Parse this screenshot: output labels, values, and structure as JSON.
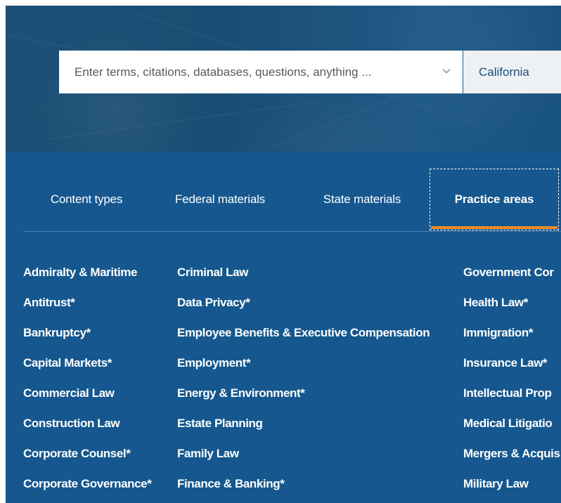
{
  "search": {
    "placeholder": "Enter terms, citations, databases, questions, anything ...",
    "value": "",
    "dropdown_icon": "chevron-down-icon",
    "jurisdiction": "California"
  },
  "tabs": [
    {
      "label": "Content types",
      "active": false
    },
    {
      "label": "Federal materials",
      "active": false
    },
    {
      "label": "State materials",
      "active": false
    },
    {
      "label": "Practice areas",
      "active": true
    }
  ],
  "practice_areas": {
    "columns": [
      [
        "Admiralty & Maritime",
        "Antitrust*",
        "Bankruptcy*",
        "Capital Markets*",
        "Commercial Law",
        "Construction Law",
        "Corporate Counsel*",
        "Corporate Governance*"
      ],
      [
        "Criminal Law",
        "Data Privacy*",
        "Employee Benefits & Executive Compensation",
        "Employment*",
        "Energy & Environment*",
        "Estate Planning",
        "Family Law",
        "Finance & Banking*"
      ],
      [
        "Government Cor",
        "Health Law*",
        "Immigration*",
        "Insurance Law*",
        "Intellectual Prop",
        "Medical Litigatio",
        "Mergers & Acquis",
        "Military Law"
      ]
    ]
  },
  "colors": {
    "panel_background": "#15578e",
    "active_tab_indicator": "#f08a24",
    "link_text": "#ffffff",
    "search_background": "#ffffff",
    "jurisdiction_background": "#eef1f4"
  }
}
